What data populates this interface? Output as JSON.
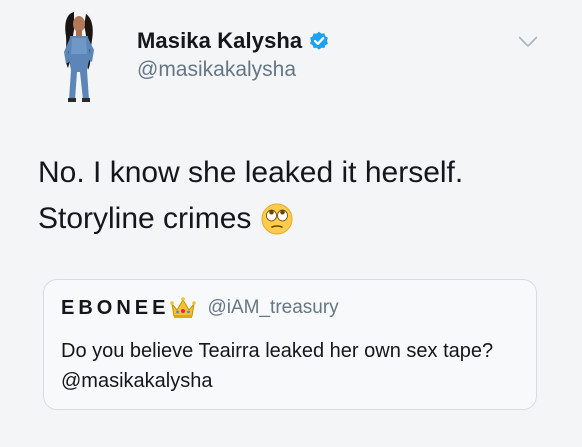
{
  "author": {
    "display_name": "Masika Kalysha",
    "handle": "@masikakalysha",
    "verified": true,
    "avatar_icon": "profile-photo"
  },
  "tweet": {
    "lines": [
      "No. I know she leaked it herself.",
      "Storyline crimes"
    ],
    "emoji": "face-with-rolling-eyes"
  },
  "quoted_tweet": {
    "display_name": "EBONEE",
    "name_emoji": "crown",
    "handle": "@iAM_treasury",
    "text": "Do you believe Teairra leaked her own sex tape? @masikakalysha"
  },
  "colors": {
    "verified_badge": "#1da1f2",
    "secondary_text": "#657786",
    "primary_text": "#14171a"
  },
  "icons": {
    "menu": "chevron-down-icon",
    "verified": "verified-badge-icon"
  }
}
